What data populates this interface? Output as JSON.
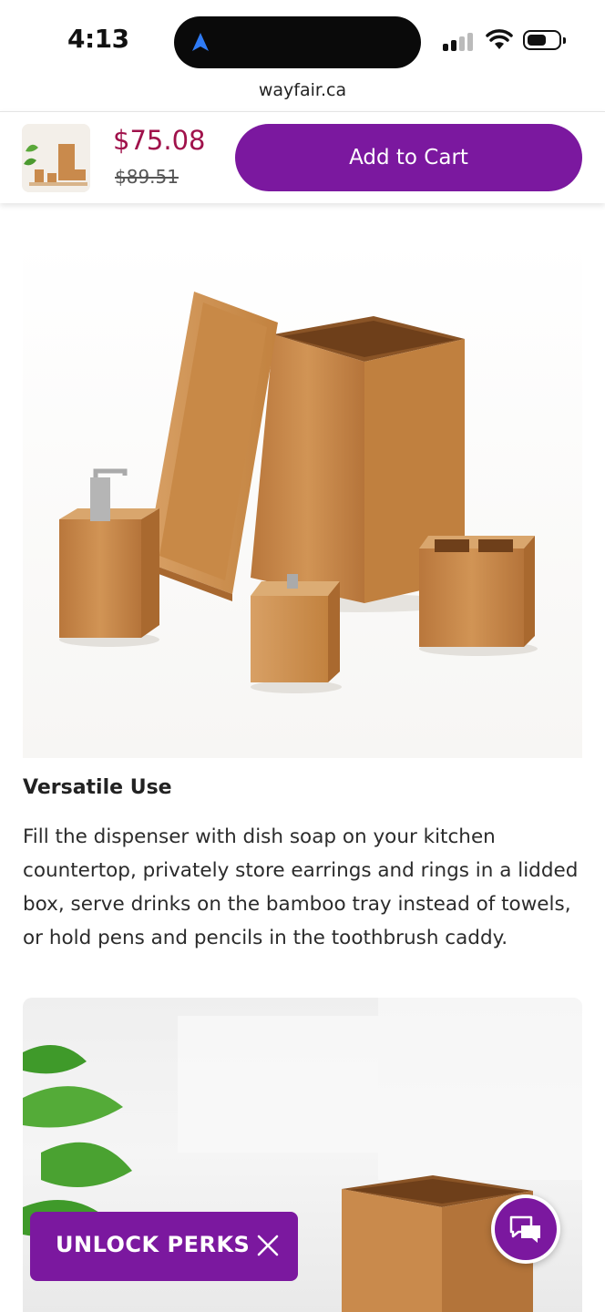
{
  "status_bar": {
    "time": "4:13"
  },
  "browser": {
    "url": "wayfair.ca"
  },
  "sticky_bar": {
    "price": "$75.08",
    "original_price": "$89.51",
    "add_to_cart_label": "Add to Cart"
  },
  "feature": {
    "heading": "Versatile Use",
    "description": "Fill the dispenser with dish soap on your kitchen countertop, privately store earrings and rings in a lidded box, serve drinks on the bamboo tray instead of towels, or hold pens and pencils in the toothbrush caddy."
  },
  "promo": {
    "label": "UNLOCK PERKS"
  },
  "colors": {
    "brand_purple": "#7b189f",
    "sale_price": "#a0124b",
    "bamboo": "#c98a4c"
  },
  "icons": [
    "navigation-arrow-icon",
    "signal-icon",
    "wifi-icon",
    "battery-icon",
    "close-icon",
    "chat-icon"
  ]
}
